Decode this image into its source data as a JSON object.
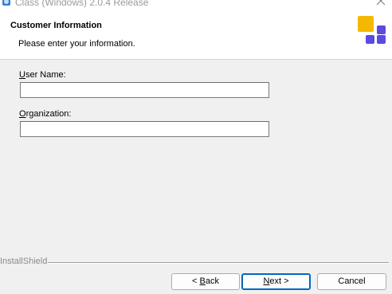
{
  "window": {
    "title": "Class (Windows) 2.0.4 Release",
    "close_icon": "close-icon"
  },
  "header": {
    "title": "Customer Information",
    "subtitle": "Please enter your information.",
    "logo_colors": {
      "yellow": "#f5b800",
      "purple": "#5b4be0"
    }
  },
  "form": {
    "user_name": {
      "label_accel": "U",
      "label_rest": "ser Name:",
      "value": ""
    },
    "organization": {
      "label_accel": "O",
      "label_rest": "rganization:",
      "value": ""
    }
  },
  "footer": {
    "brand": "InstallShield",
    "back": {
      "prefix": "< ",
      "accel": "B",
      "rest": "ack"
    },
    "next": {
      "accel": "N",
      "rest": "ext >"
    },
    "cancel": "Cancel"
  }
}
